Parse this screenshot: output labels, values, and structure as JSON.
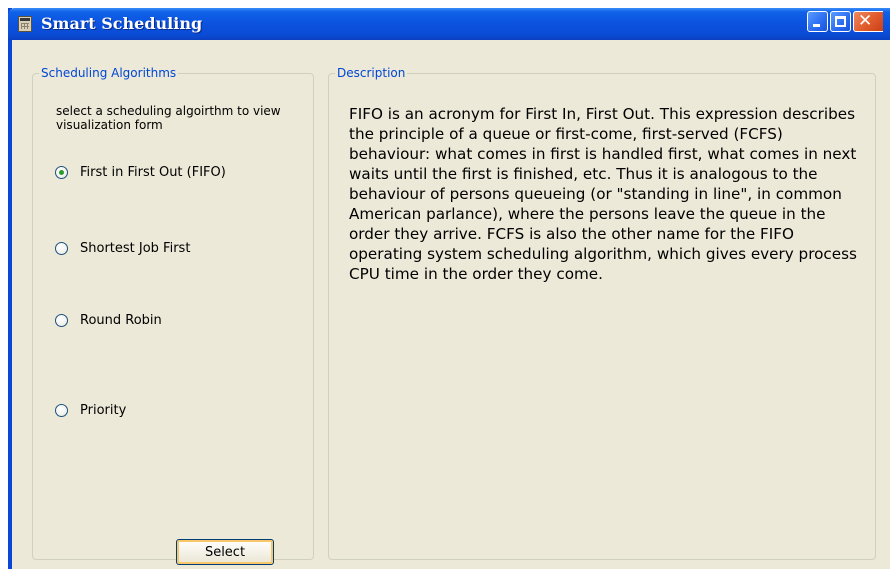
{
  "window": {
    "title": "Smart Scheduling",
    "icon": "calculator-app-icon"
  },
  "titlebar_buttons": {
    "minimize": "minimize-icon",
    "maximize": "maximize-icon",
    "close_glyph": "✕"
  },
  "scheduling": {
    "legend": "Scheduling Algorithms",
    "instructions": "select a scheduling algoirthm to view visualization form",
    "options": [
      {
        "label": "First in First Out (FIFO)",
        "checked": true
      },
      {
        "label": "Shortest Job First",
        "checked": false
      },
      {
        "label": "Round Robin",
        "checked": false
      },
      {
        "label": "Priority",
        "checked": false
      }
    ],
    "select_label": "Select"
  },
  "description": {
    "legend": "Description",
    "text": "FIFO is an acronym for First In, First Out. This expression describes the principle of a queue or first-come, first-served (FCFS) behaviour: what comes in first is handled first, what comes in next waits until the first is finished, etc. Thus it is analogous to the behaviour of persons queueing (or \"standing in line\", in common American parlance), where the persons leave the queue in the order they arrive. FCFS is also the other name for the FIFO operating system scheduling algorithm, which gives every process CPU time in the order they come."
  },
  "colors": {
    "titlebar": "#0b52df",
    "legend_text": "#0046d5",
    "window_bg": "#ece9d8",
    "radio_checked": "#2a9a2a"
  }
}
